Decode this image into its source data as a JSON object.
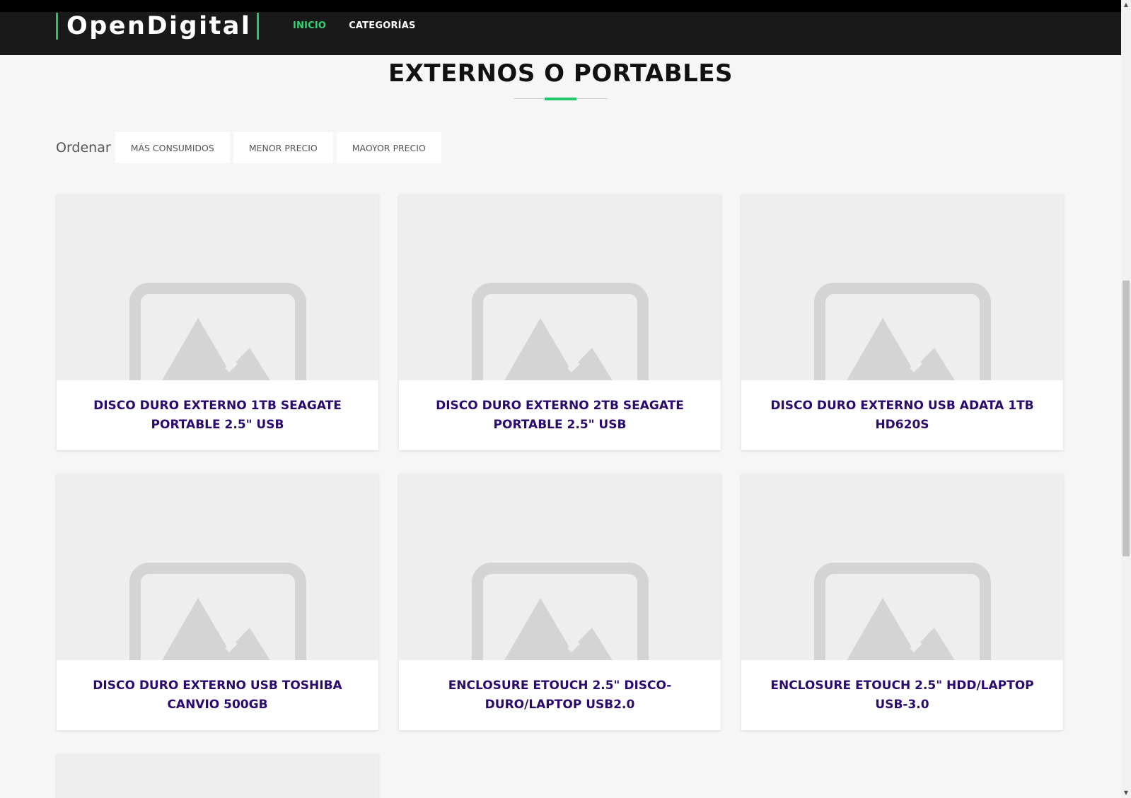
{
  "header": {
    "logo": "OpenDigital",
    "nav": [
      {
        "label": "INICIO",
        "active": true
      },
      {
        "label": "CATEGORÍAS",
        "active": false
      }
    ],
    "accent_color": "#2ed573"
  },
  "page": {
    "title": "EXTERNOS O PORTABLES"
  },
  "sort": {
    "label": "Ordenar",
    "options": [
      "MÁS CONSUMIDOS",
      "MENOR PRECIO",
      "MAOYOR PRECIO"
    ]
  },
  "products": [
    {
      "title": "DISCO DURO EXTERNO 1TB SEAGATE PORTABLE 2.5\" USB",
      "image_icon": "image-placeholder-icon"
    },
    {
      "title": "DISCO DURO EXTERNO 2TB SEAGATE PORTABLE 2.5\" USB",
      "image_icon": "image-placeholder-icon"
    },
    {
      "title": "DISCO DURO EXTERNO USB ADATA 1TB HD620S",
      "image_icon": "image-placeholder-icon"
    },
    {
      "title": "DISCO DURO EXTERNO USB TOSHIBA CANVIO 500GB",
      "image_icon": "image-placeholder-icon"
    },
    {
      "title": "ENCLOSURE ETOUCH 2.5\" DISCO-DURO/LAPTOP USB2.0",
      "image_icon": "image-placeholder-icon"
    },
    {
      "title": "ENCLOSURE ETOUCH 2.5\" HDD/LAPTOP USB-3.0",
      "image_icon": "image-placeholder-icon"
    }
  ],
  "colors": {
    "header_bg": "#191919",
    "product_title": "#2b0a6e",
    "page_bg": "#f6f6f6"
  }
}
